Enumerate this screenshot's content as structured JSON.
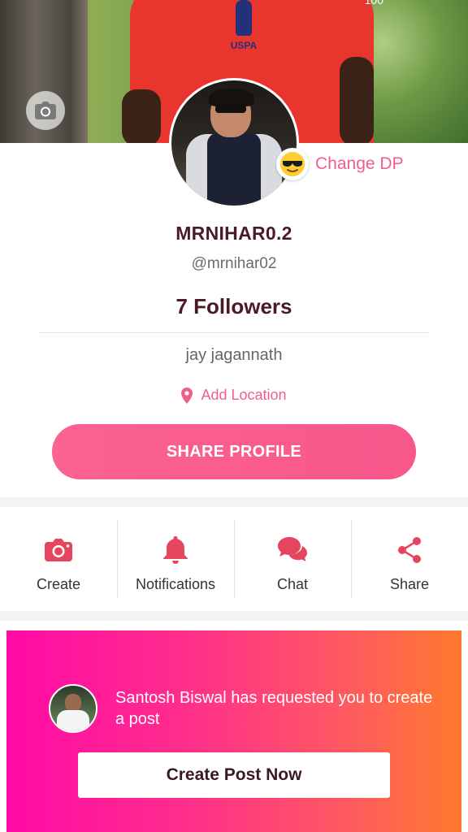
{
  "cover": {
    "top_number": "100"
  },
  "profile": {
    "name": "MRNIHAR0.2",
    "handle": "@mrnihar02",
    "followers": "7 Followers",
    "bio": "jay jagannath",
    "location_label": "Add Location",
    "change_dp_label": "Change DP",
    "share_profile_label": "SHARE PROFILE"
  },
  "actions": [
    {
      "label": "Create",
      "icon": "camera-icon"
    },
    {
      "label": "Notifications",
      "icon": "bell-icon"
    },
    {
      "label": "Chat",
      "icon": "chat-bubbles-icon"
    },
    {
      "label": "Share",
      "icon": "share-icon"
    }
  ],
  "request_card": {
    "message": "Santosh Biswal has requested you to create a post",
    "cta_label": "Create Post Now"
  },
  "colors": {
    "accent": "#f8578a",
    "dark_text": "#4a1b24",
    "gradient_start": "#ff0aa8",
    "gradient_end": "#ff7a2d"
  }
}
